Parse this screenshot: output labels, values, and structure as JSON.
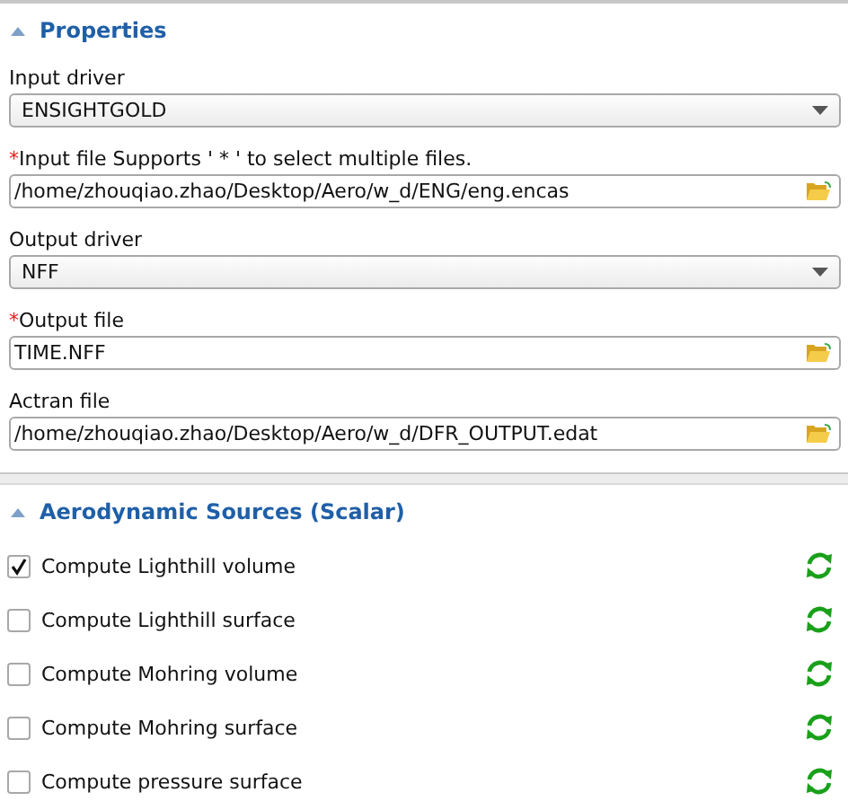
{
  "properties": {
    "title": "Properties",
    "expanded": true,
    "fields": [
      {
        "kind": "dropdown",
        "label": "Input driver",
        "value": "ENSIGHTGOLD"
      },
      {
        "kind": "file",
        "required_mark": "*",
        "label": "Input file Supports ' * ' to select multiple files.",
        "value": "/home/zhouqiao.zhao/Desktop/Aero/w_d/ENG/eng.encas"
      },
      {
        "kind": "dropdown",
        "label": "Output driver",
        "value": "NFF"
      },
      {
        "kind": "file",
        "required_mark": "*",
        "label": "Output file",
        "value": "TIME.NFF"
      },
      {
        "kind": "file",
        "label": "Actran file",
        "value": "/home/zhouqiao.zhao/Desktop/Aero/w_d/DFR_OUTPUT.edat"
      }
    ]
  },
  "aerodynamic_sources": {
    "title": "Aerodynamic Sources (Scalar)",
    "expanded": true,
    "options": [
      {
        "label": "Compute Lighthill volume",
        "checked": true
      },
      {
        "label": "Compute Lighthill surface",
        "checked": false
      },
      {
        "label": "Compute Mohring volume",
        "checked": false
      },
      {
        "label": "Compute Mohring surface",
        "checked": false
      },
      {
        "label": "Compute pressure surface",
        "checked": false
      }
    ]
  }
}
